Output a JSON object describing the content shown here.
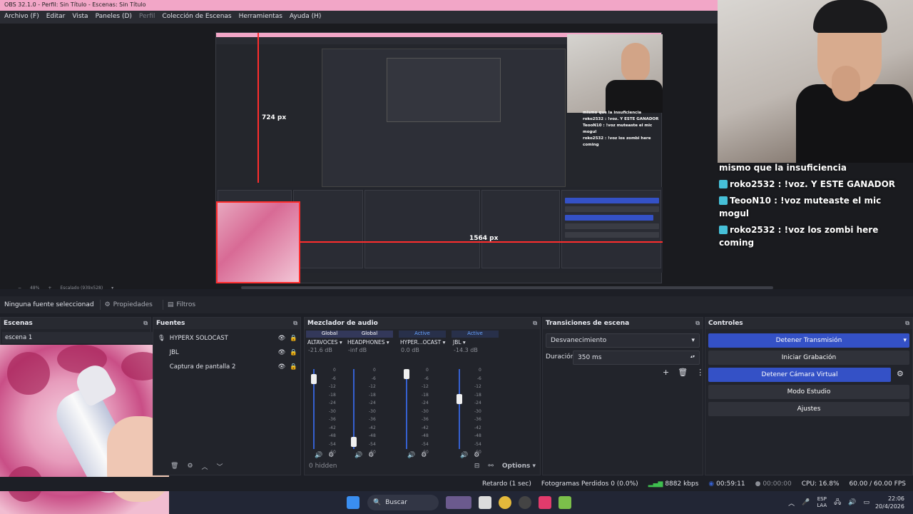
{
  "window": {
    "title": "OBS 32.1.0 - Perfil: Sin Título - Escenas: Sin Título"
  },
  "menu": [
    "Archivo (F)",
    "Editar",
    "Vista",
    "Paneles (D)",
    "Perfil",
    "Colección de Escenas",
    "Herramientas",
    "Ayuda (H)"
  ],
  "preview": {
    "measure_v": "724 px",
    "measure_h": "1564 px",
    "zoom": "48%",
    "scaled": "Escalado (939x528)"
  },
  "chat": [
    {
      "user": "",
      "text": "mismo que la insuficiencia"
    },
    {
      "user": "roko2532",
      "text": " : !voz. Y ESTE GANADOR"
    },
    {
      "user": "TeooN10",
      "text": " : !voz muteaste el mic mogul"
    },
    {
      "user": "roko2532",
      "text": " : !voz los zombi here coming"
    }
  ],
  "toolbar": {
    "no_source": "Ninguna fuente seleccionad",
    "properties": "Propiedades",
    "filters": "Filtros"
  },
  "scenes": {
    "title": "Escenas",
    "items": [
      "escena 1"
    ]
  },
  "sources": {
    "title": "Fuentes",
    "items": [
      "HYPERX SOLOCAST",
      "JBL",
      "Captura de pantalla 2"
    ]
  },
  "mixer": {
    "title": "Mezclador de audio",
    "hidden": "0 hidden",
    "options": "Options",
    "channels": [
      {
        "tag": "Global",
        "name": "ALTAVOCES",
        "db": "-21.6 dB",
        "level": 0.0,
        "fader": 0.93
      },
      {
        "tag": "Global",
        "name": "HEADPHONES",
        "db": "-inf dB",
        "level": 0.0,
        "fader": 0.05
      },
      {
        "tag": "Active",
        "name": "HYPER...OCAST",
        "db": "0.0 dB",
        "level": 0.18,
        "fader": 1.0
      },
      {
        "tag": "Active",
        "name": "JBL",
        "db": "-14.3 dB",
        "level": 0.55,
        "fader": 0.65
      }
    ],
    "scale": [
      "0",
      "-6",
      "-12",
      "-18",
      "-24",
      "-30",
      "-36",
      "-42",
      "-48",
      "-54",
      "-60"
    ]
  },
  "transitions": {
    "title": "Transiciones de escena",
    "selected": "Desvanecimiento",
    "duration_label": "Duración",
    "duration_value": "350 ms"
  },
  "controls": {
    "title": "Controles",
    "stop_stream": "Detener Transmisión",
    "start_record": "Iniciar Grabación",
    "stop_vcam": "Detener Cámara Virtual",
    "studio": "Modo Estudio",
    "settings": "Ajustes"
  },
  "status": {
    "delay": "Retardo (1 sec)",
    "dropped": "Fotogramas Perdidos 0 (0.0%)",
    "kbps": "8882 kbps",
    "stream_time": "00:59:11",
    "rec_time": "00:00:00",
    "cpu": "CPU: 16.8%",
    "fps": "60.00 / 60.00 FPS"
  },
  "taskbar": {
    "search": "Buscar",
    "lang": "ESP",
    "lang2": "LAA",
    "time": "22:06",
    "date": "20/4/2026"
  },
  "colors": {
    "accent": "#3451c6",
    "title_bg": "#f2a6c7",
    "meter_green": "#2fbf3c",
    "fader_blue": "#3560d0"
  }
}
